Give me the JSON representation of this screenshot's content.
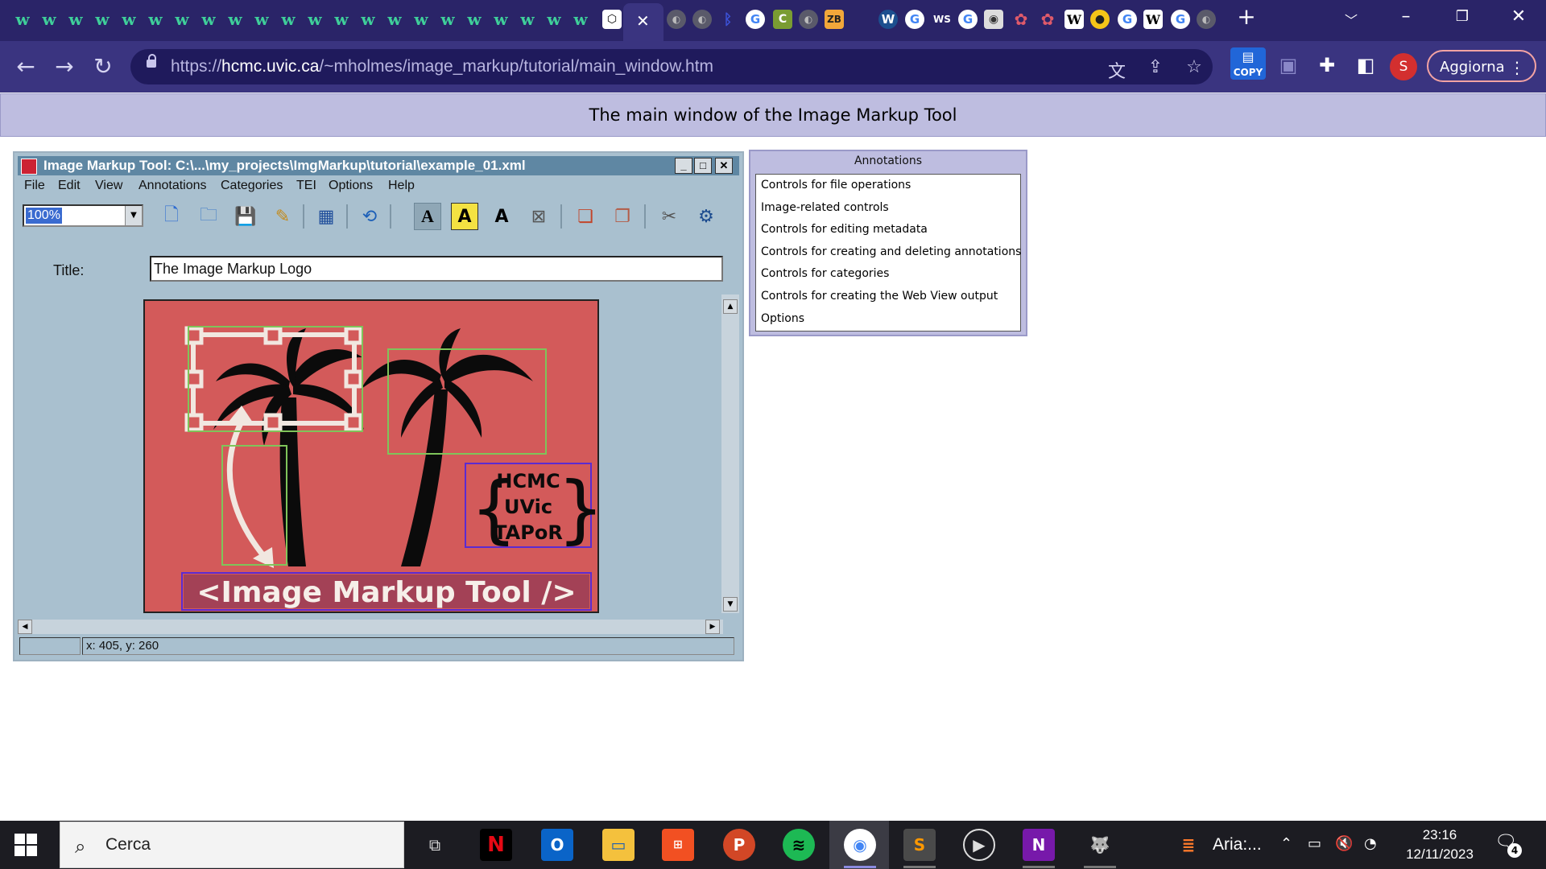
{
  "browser": {
    "url_prefix": "https://",
    "url_host": "hcmc.uvic.ca",
    "url_path": "/~mholmes/image_markup/tutorial/main_window.htm",
    "close_tab_glyph": "✕",
    "new_tab_glyph": "+",
    "copy_ext_label": "COPY",
    "profile_initial": "S",
    "update_label": "Aggiorna",
    "update_menu_glyph": "⋮"
  },
  "page": {
    "header": "The main window of the Image Markup Tool"
  },
  "imt": {
    "window_title": "Image Markup Tool: C:\\...\\my_projects\\ImgMarkup\\tutorial\\example_01.xml",
    "menu": [
      "File",
      "Edit",
      "View",
      "Annotations",
      "Categories",
      "TEI",
      "Options",
      "Help"
    ],
    "zoom_value": "100%",
    "title_label": "Title:",
    "title_value": "The Image Markup Logo",
    "status_left": "",
    "status_coords": "x: 405, y: 260",
    "canvas": {
      "logo_lines": [
        "HCMC",
        "UVic",
        "TAPoR"
      ],
      "banner": "<Image Markup Tool />"
    }
  },
  "annotations": {
    "title": "Annotations",
    "items": [
      "Controls for file operations",
      "Image-related controls",
      "Controls for editing metadata",
      "Controls for creating and deleting annotations",
      "Controls for categories",
      "Controls for creating the Web View output",
      "Options"
    ]
  },
  "taskbar": {
    "search_placeholder": "Cerca",
    "aria_label": "Aria:...",
    "time": "23:16",
    "date": "12/11/2023",
    "notification_count": "4"
  },
  "colors": {
    "tab_strip": "#2a2468",
    "toolbar": "#3a3480",
    "page_header_bg": "#bebde0",
    "imt_window_bg": "#a9c0cf",
    "canvas_bg": "#d35a5a",
    "annotation_box_green": "#7fc45a",
    "annotation_box_purple": "#5b2bd1"
  }
}
